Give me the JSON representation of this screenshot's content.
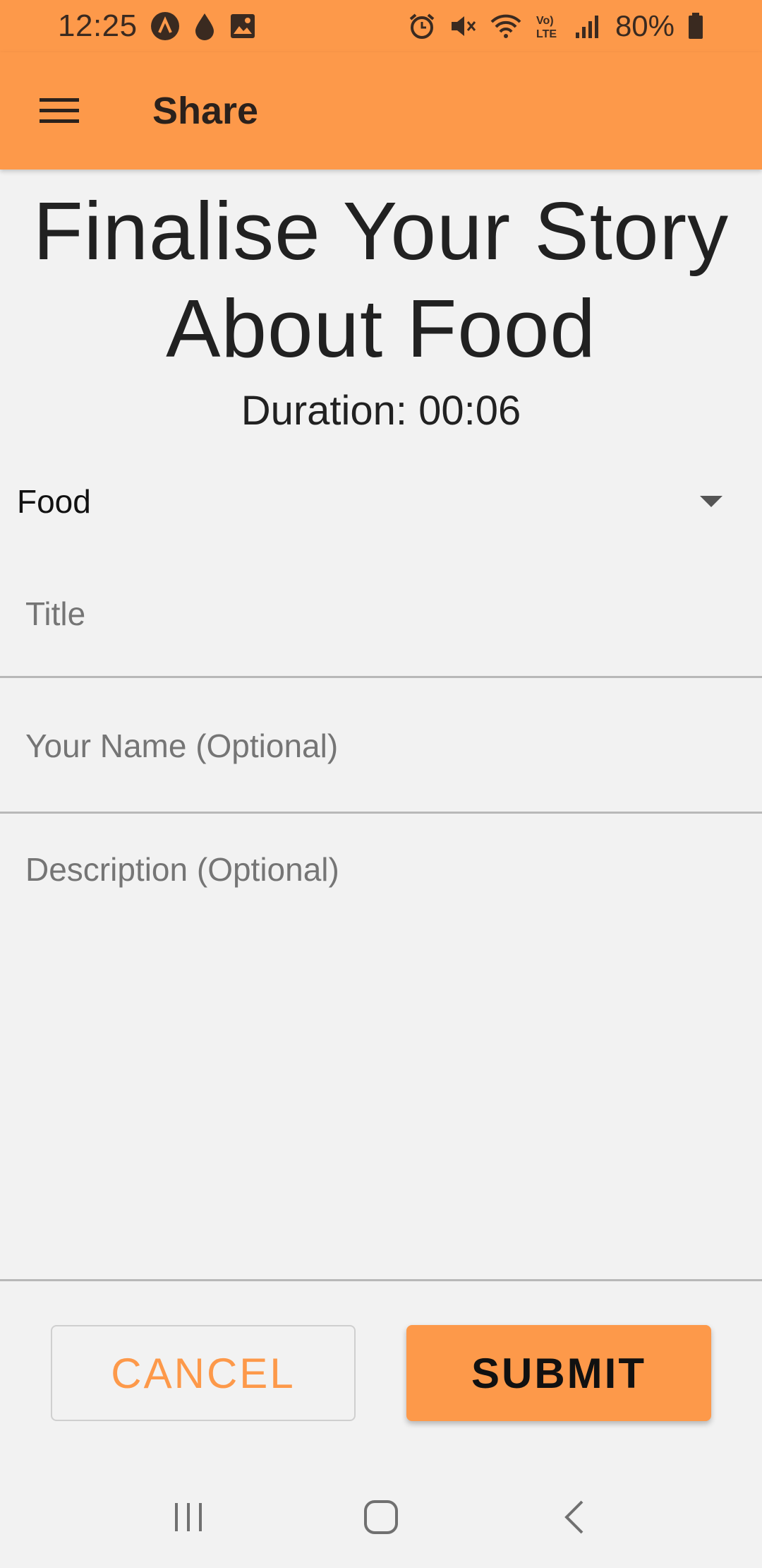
{
  "status_bar": {
    "time": "12:25",
    "battery": "80%",
    "icons_left": [
      "assistant-icon",
      "drop-icon",
      "image-icon"
    ],
    "icons_right": [
      "alarm-icon",
      "mute-icon",
      "wifi-icon",
      "volte-icon",
      "signal-icon",
      "battery-icon"
    ]
  },
  "app_bar": {
    "title": "Share",
    "menu_icon": "menu-icon",
    "color": "#fd994a"
  },
  "page": {
    "headline_line1": "Finalise Your Story",
    "headline_line2": "About Food",
    "duration_label": "Duration: 00:06"
  },
  "form": {
    "category": "Food",
    "title_placeholder": "Title",
    "title_value": "",
    "name_placeholder": "Your Name (Optional)",
    "name_value": "",
    "description_placeholder": "Description (Optional)",
    "description_value": ""
  },
  "actions": {
    "cancel_label": "CANCEL",
    "submit_label": "SUBMIT",
    "accent_color": "#fd994a"
  },
  "nav_bar": {
    "icons": [
      "recent-apps-icon",
      "home-icon",
      "back-icon"
    ]
  }
}
